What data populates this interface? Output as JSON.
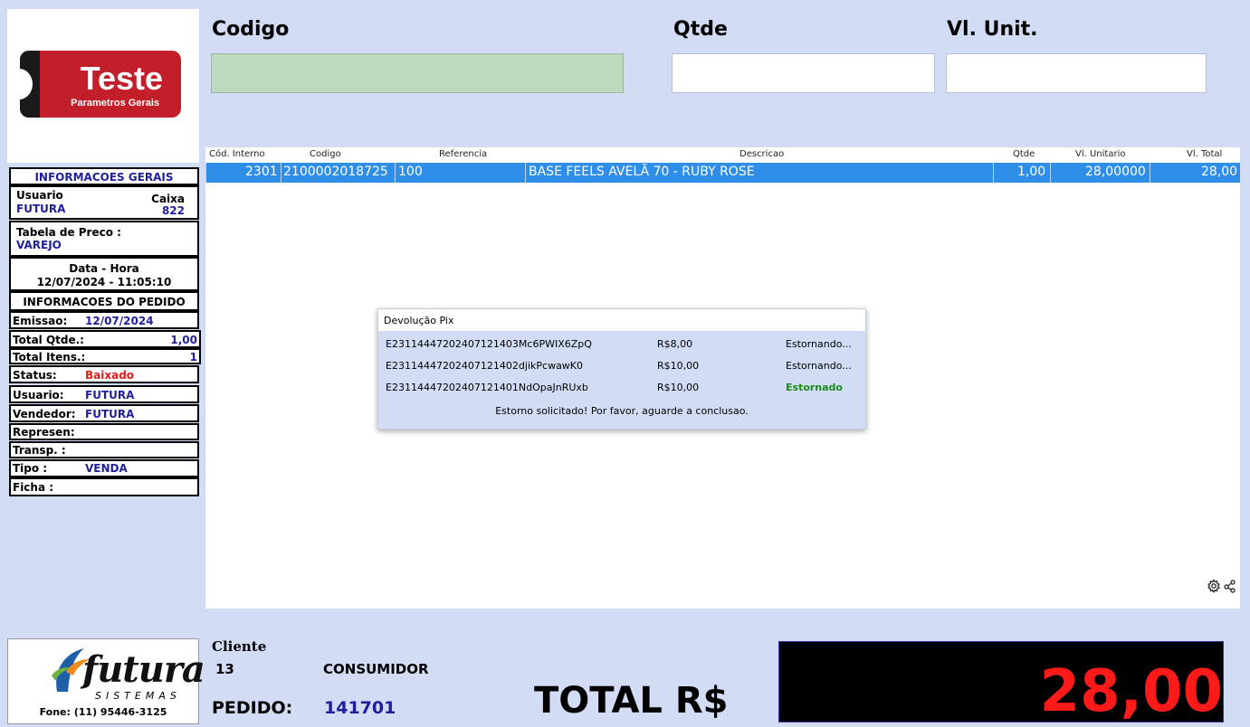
{
  "logo": {
    "title": "Teste",
    "subtitle": "Parametros Gerais"
  },
  "header": {
    "codigo_label": "Codigo",
    "qtde_label": "Qtde",
    "vl_unit_label": "Vl. Unit.",
    "codigo_value": "",
    "qtde_value": "",
    "vl_unit_value": ""
  },
  "grid": {
    "columns": [
      "Cód. Interno",
      "Codigo",
      "Referencia",
      "Descricao",
      "Qtde",
      "Vl. Unitario",
      "Vl. Total"
    ],
    "rows": [
      {
        "cod_interno": "2301",
        "codigo": "2100002018725",
        "referencia": "100",
        "descricao": "BASE FEELS AVELÃ 70 - RUBY ROSE",
        "qtde": "1,00",
        "vl_unitario": "28,00000",
        "vl_total": "28,00"
      }
    ]
  },
  "info": {
    "title": "INFORMACOES GERAIS",
    "usuario_label": "Usuario",
    "usuario_value": "FUTURA",
    "caixa_label": "Caixa",
    "caixa_value": "822",
    "tabela_label": "Tabela de Preco :",
    "tabela_value": "VAREJO",
    "datahora_label": "Data - Hora",
    "datahora_value": "12/07/2024 - 11:05:10"
  },
  "pedido_info": {
    "title": "INFORMACOES DO PEDIDO",
    "emissao_label": "Emissao:",
    "emissao_value": "12/07/2024",
    "total_qtde_label": "Total Qtde.:",
    "total_qtde_value": "1,00",
    "total_itens_label": "Total Itens.:",
    "total_itens_value": "1",
    "status_label": "Status:",
    "status_value": "Baixado",
    "usuario_label": "Usuario:",
    "usuario_value": "FUTURA",
    "vendedor_label": "Vendedor:",
    "vendedor_value": "FUTURA",
    "represen_label": "Represen:",
    "transp_label": "Transp. :",
    "tipo_label": "Tipo :",
    "tipo_value": "VENDA",
    "ficha_label": "Ficha :"
  },
  "dialog": {
    "title": "Devolução Pix",
    "rows": [
      {
        "id": "E23114447202407121403Mc6PWIX6ZpQ",
        "valor": "R$8,00",
        "status": "Estornando..."
      },
      {
        "id": "E23114447202407121402djikPcwawK0",
        "valor": "R$10,00",
        "status": "Estornando..."
      },
      {
        "id": "E23114447202407121401NdOpaJnRUxb",
        "valor": "R$10,00",
        "status": "Estornado"
      }
    ],
    "message": "Estorno solicitado! Por favor, aguarde a conclusao."
  },
  "footer": {
    "brand": "futura",
    "brand_sub": "SISTEMAS",
    "phone": "Fone: (11) 95446-3125",
    "cliente_label": "Cliente",
    "cliente_code": "13",
    "cliente_name": "CONSUMIDOR",
    "pedido_label": "PEDIDO:",
    "pedido_value": "141701",
    "total_label": "TOTAL R$",
    "total_value": "28,00"
  },
  "colors": {
    "status_baixado": "#e01b1b",
    "estornado": "#1a8b1a",
    "selection": "#2f8fe8",
    "total": "#ff1a1a"
  }
}
